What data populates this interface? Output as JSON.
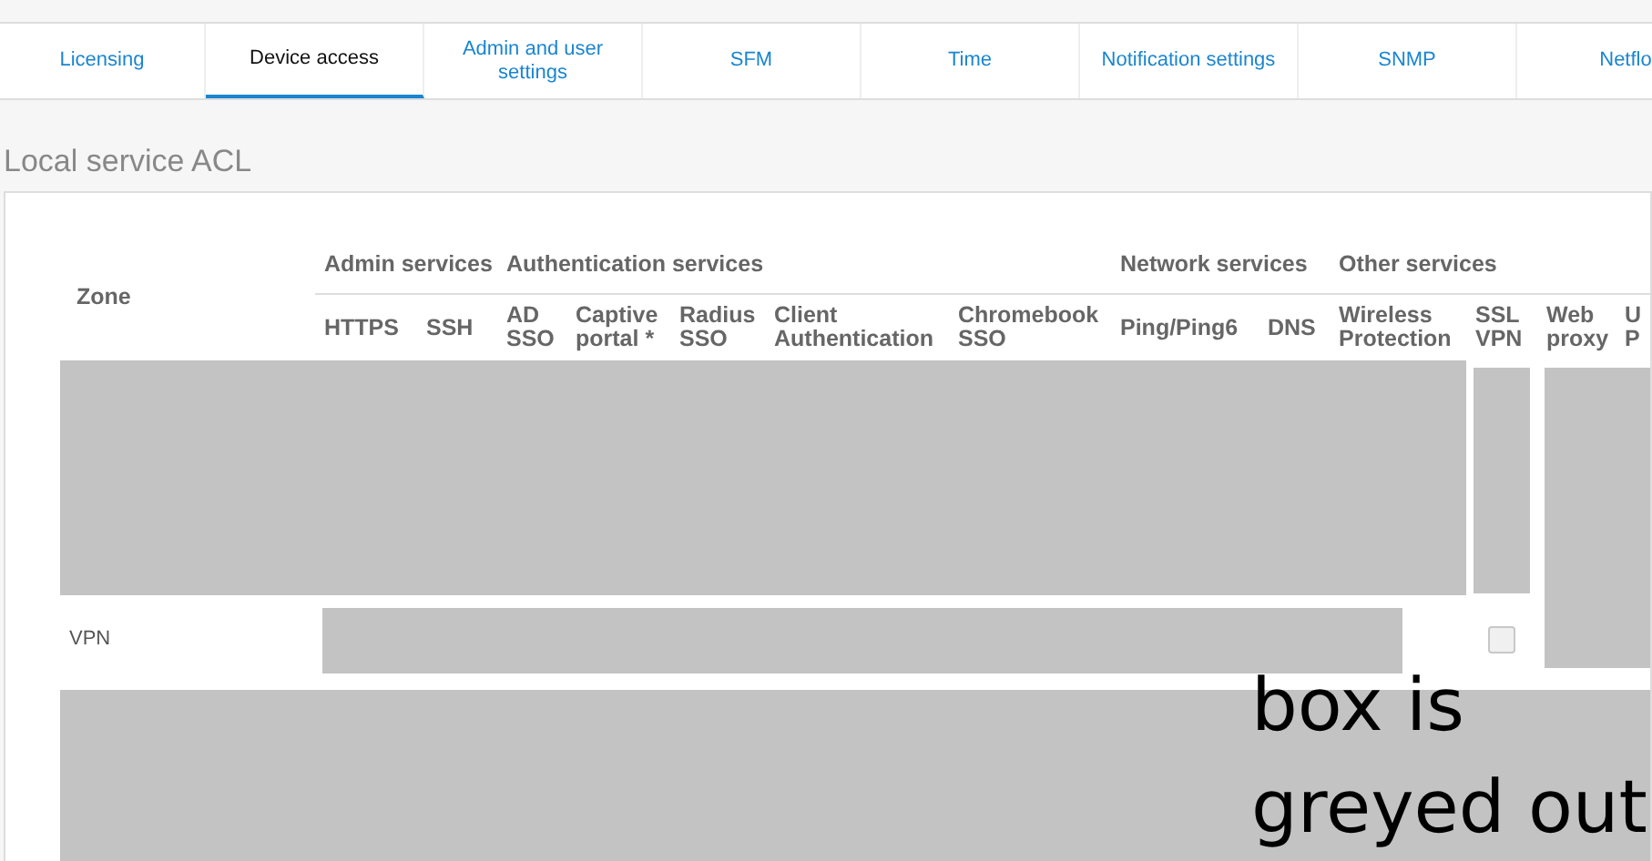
{
  "tabs": [
    {
      "label": "Licensing",
      "selected": false
    },
    {
      "label": "Device access",
      "selected": true
    },
    {
      "label": "Admin and user settings",
      "selected": false
    },
    {
      "label": "SFM",
      "selected": false
    },
    {
      "label": "Time",
      "selected": false
    },
    {
      "label": "Notification settings",
      "selected": false
    },
    {
      "label": "SNMP",
      "selected": false
    },
    {
      "label": "Netflo",
      "selected": false
    }
  ],
  "section_title": "Local service ACL",
  "table": {
    "zone_header": "Zone",
    "groups": [
      {
        "label": "Admin services",
        "columns": [
          [
            "HTTPS"
          ],
          [
            "SSH"
          ]
        ]
      },
      {
        "label": "Authentication services",
        "columns": [
          [
            "AD",
            "SSO"
          ],
          [
            "Captive",
            "portal *"
          ],
          [
            "Radius",
            "SSO"
          ],
          [
            "Client",
            "Authentication"
          ],
          [
            "Chromebook",
            "SSO"
          ]
        ]
      },
      {
        "label": "Network services",
        "columns": [
          [
            "Ping/Ping6"
          ],
          [
            "DNS"
          ]
        ]
      },
      {
        "label": "Other services",
        "columns": [
          [
            "Wireless",
            "Protection"
          ],
          [
            "SSL",
            "VPN"
          ],
          [
            "Web",
            "proxy"
          ],
          [
            "U",
            "P"
          ]
        ]
      }
    ],
    "vpn_row": {
      "zone": "VPN",
      "ssl_vpn": {
        "checked": false,
        "disabled": true
      }
    }
  },
  "annotation": "box is greyed out"
}
